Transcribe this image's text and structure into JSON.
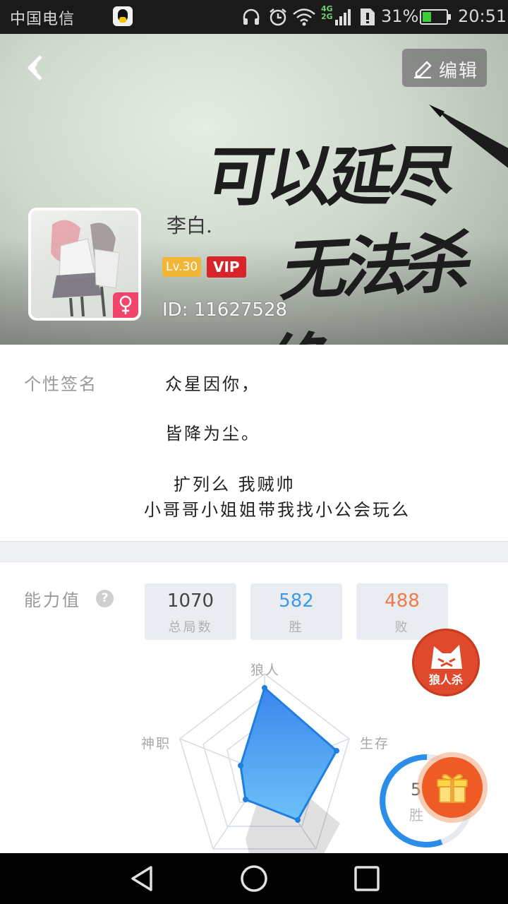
{
  "status_bar": {
    "carrier": "中国电信",
    "battery_percent": "31%",
    "time": "20:51",
    "network": {
      "top": "4G",
      "bottom": "2G"
    },
    "icons": [
      "qq-icon",
      "headphone-icon",
      "alarm-icon",
      "wifi-icon",
      "signal-icon",
      "sim-icon",
      "battery-icon"
    ]
  },
  "header": {
    "edit_label": "编辑",
    "calligraphy": {
      "line1": "可以延尽",
      "line2": "无法杀绝"
    },
    "username": "李白.",
    "level": "Lv.30",
    "vip": "VIP",
    "id": "ID: 11627528"
  },
  "signature": {
    "label": "个性签名",
    "lines": [
      "众星因你，",
      "皆降为尘。",
      "扩列么 我贼帅",
      "小哥哥小姐姐带我找小公会玩么"
    ]
  },
  "ability": {
    "label": "能力值",
    "help": "?",
    "stats": [
      {
        "value": "1070",
        "caption": "总局数"
      },
      {
        "value": "582",
        "caption": "胜"
      },
      {
        "value": "488",
        "caption": "败"
      }
    ],
    "axes": {
      "werewolf": "狼人",
      "survival": "生存",
      "god": "神职"
    },
    "game_logo_text": "狼人杀",
    "winrate_value": "5",
    "winrate_caption": "胜"
  },
  "colors": {
    "accent_blue": "#3f9be6",
    "loss_orange": "#f07a4a",
    "vip_red": "#d8232a",
    "level_gold": "#f1b638",
    "gift_orange": "#ef5b25"
  }
}
